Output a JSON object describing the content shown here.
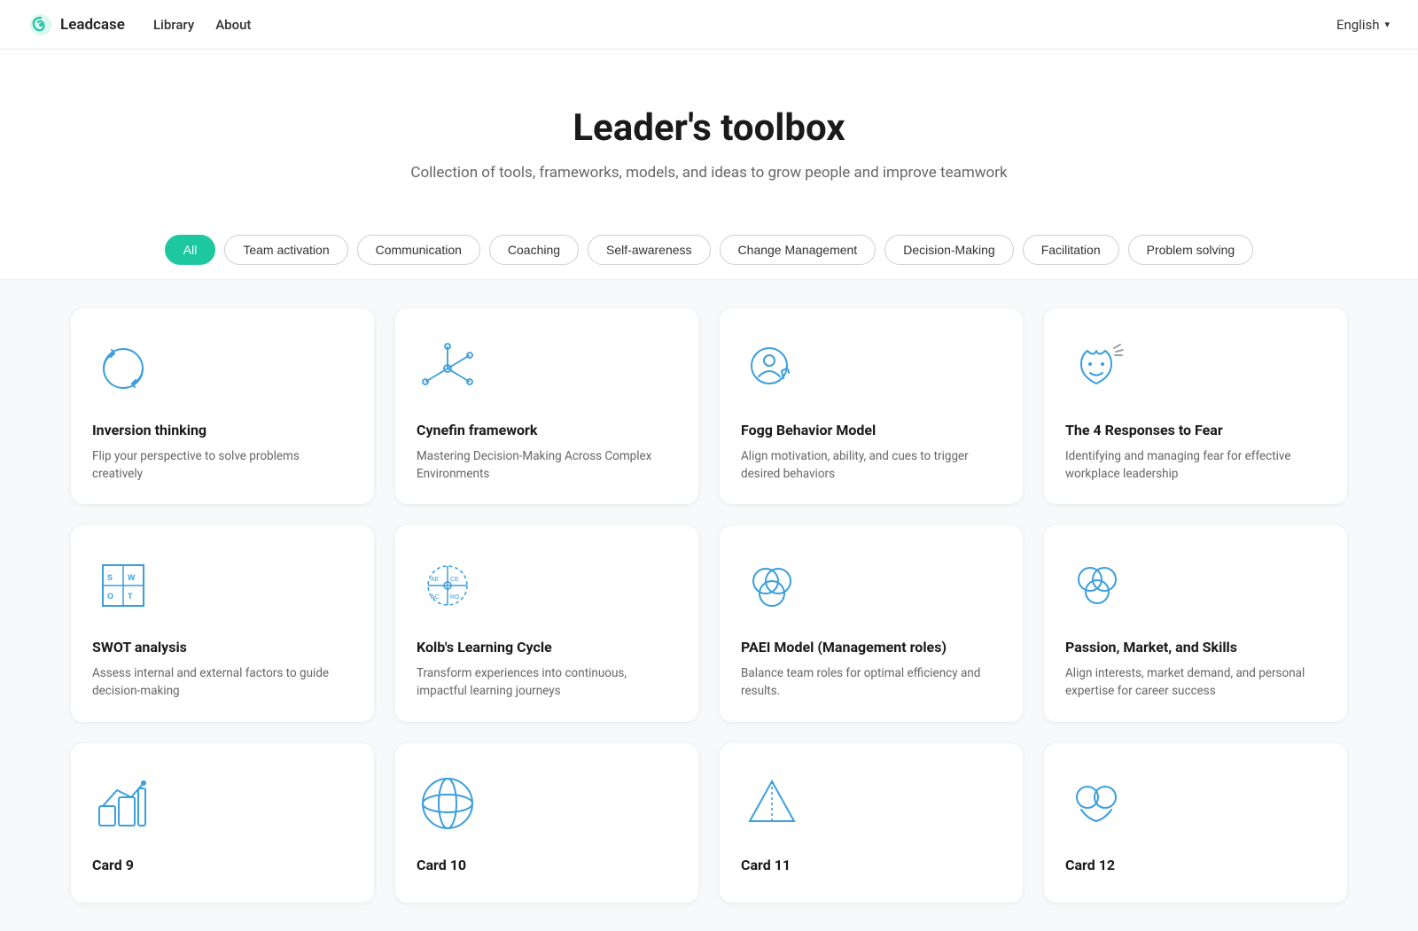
{
  "navbar": {
    "brand": "Leadcase",
    "links": [
      {
        "label": "Library",
        "href": "#"
      },
      {
        "label": "About",
        "href": "#"
      }
    ],
    "lang": "English"
  },
  "hero": {
    "title": "Leader's toolbox",
    "subtitle": "Collection of tools, frameworks, models, and ideas to grow people and improve teamwork"
  },
  "filters": [
    {
      "label": "All",
      "active": true
    },
    {
      "label": "Team activation",
      "active": false
    },
    {
      "label": "Communication",
      "active": false
    },
    {
      "label": "Coaching",
      "active": false
    },
    {
      "label": "Self-awareness",
      "active": false
    },
    {
      "label": "Change Management",
      "active": false
    },
    {
      "label": "Decision-Making",
      "active": false
    },
    {
      "label": "Facilitation",
      "active": false
    },
    {
      "label": "Problem solving",
      "active": false
    }
  ],
  "cards": [
    {
      "id": "inversion",
      "title": "Inversion thinking",
      "description": "Flip your perspective to solve problems creatively",
      "icon": "inversion"
    },
    {
      "id": "cynefin",
      "title": "Cynefin framework",
      "description": "Mastering Decision-Making Across Complex Environments",
      "icon": "cynefin"
    },
    {
      "id": "fogg",
      "title": "Fogg Behavior Model",
      "description": "Align motivation, ability, and cues to trigger desired behaviors",
      "icon": "fogg"
    },
    {
      "id": "fear",
      "title": "The 4 Responses to Fear",
      "description": "Identifying and managing fear for effective workplace leadership",
      "icon": "fear"
    },
    {
      "id": "swot",
      "title": "SWOT analysis",
      "description": "Assess internal and external factors to guide decision-making",
      "icon": "swot"
    },
    {
      "id": "kolb",
      "title": "Kolb's Learning Cycle",
      "description": "Transform experiences into continuous, impactful learning journeys",
      "icon": "kolb"
    },
    {
      "id": "paei",
      "title": "PAEI Model (Management roles)",
      "description": "Balance team roles for optimal efficiency and results.",
      "icon": "paei"
    },
    {
      "id": "passion",
      "title": "Passion, Market, and Skills",
      "description": "Align interests, market demand, and personal expertise for career success",
      "icon": "passion"
    },
    {
      "id": "card9",
      "title": "Card 9",
      "description": "",
      "icon": "card9"
    },
    {
      "id": "card10",
      "title": "Card 10",
      "description": "",
      "icon": "card10"
    },
    {
      "id": "card11",
      "title": "Card 11",
      "description": "",
      "icon": "card11"
    },
    {
      "id": "card12",
      "title": "Card 12",
      "description": "",
      "icon": "card12"
    }
  ]
}
